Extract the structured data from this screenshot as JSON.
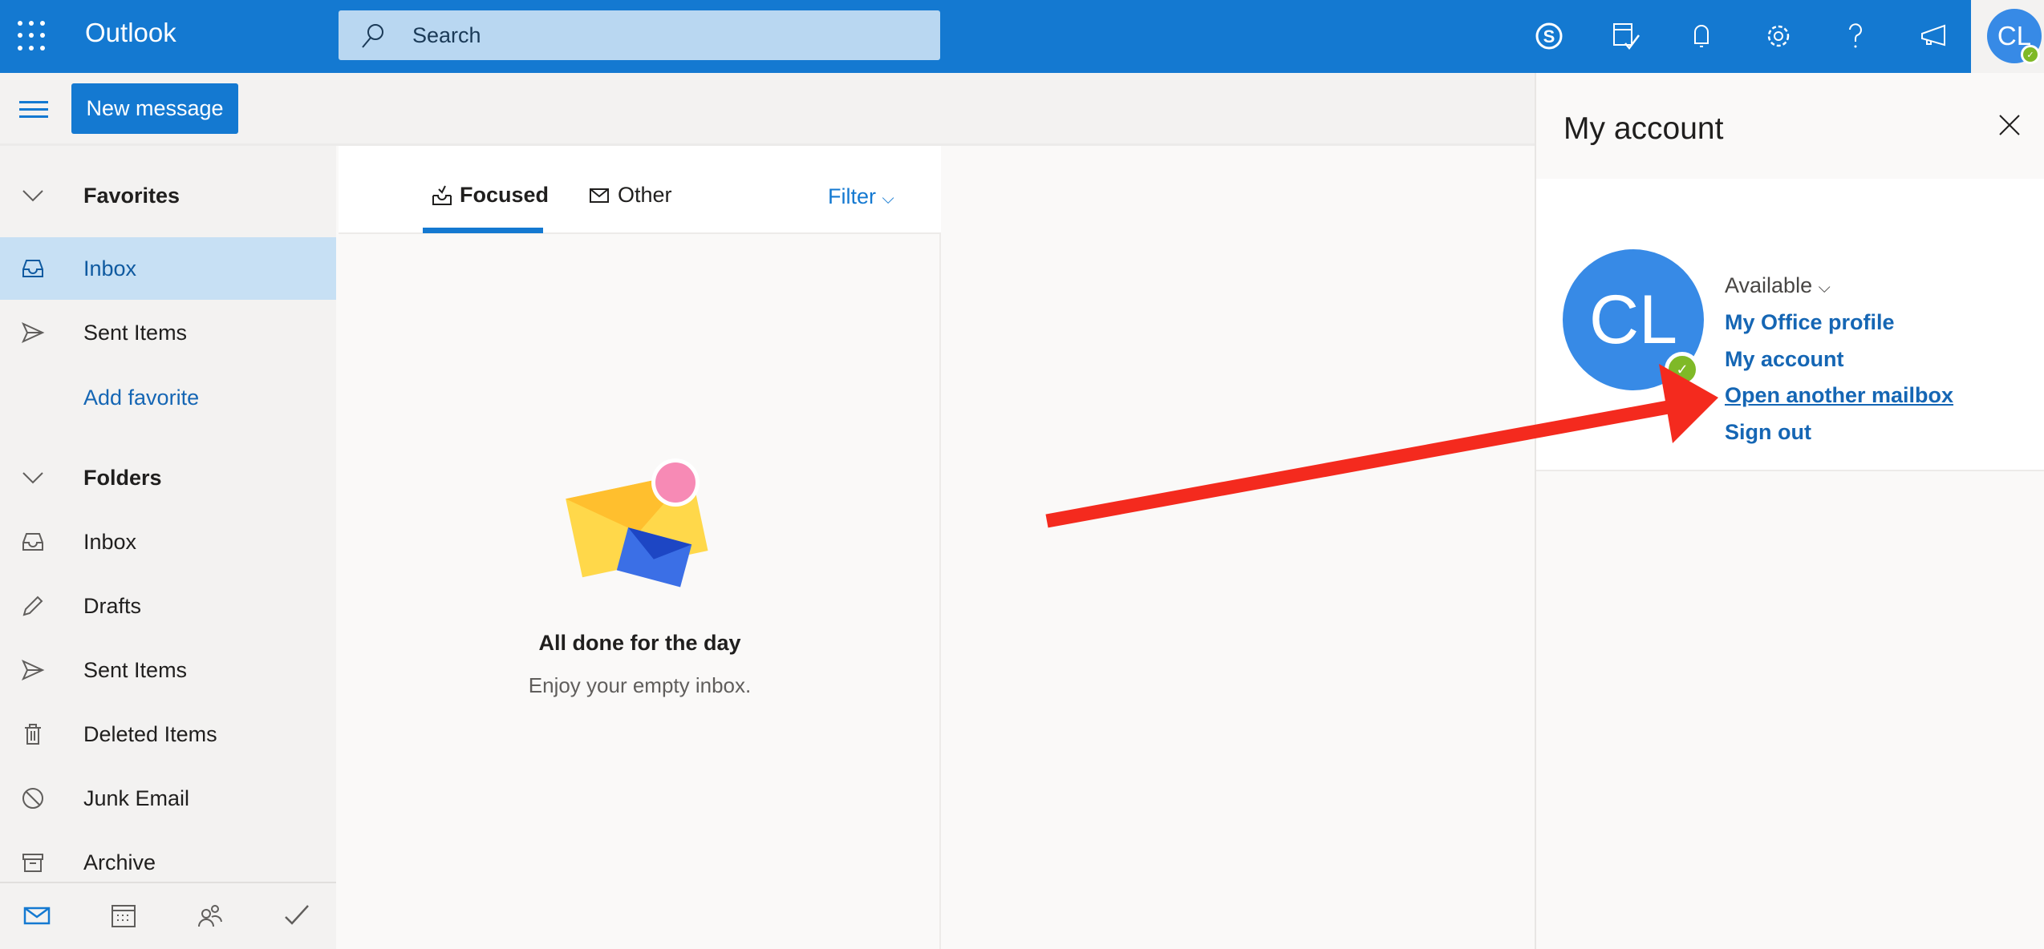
{
  "app": {
    "title": "Outlook",
    "brand_color": "#1479d1"
  },
  "search": {
    "placeholder": "Search"
  },
  "topbar": {
    "icons": [
      "skype-icon",
      "my-day-icon",
      "bell-icon",
      "gear-icon",
      "help-icon",
      "feedback-megaphone-icon"
    ],
    "avatar_initials": "CL"
  },
  "toolbar": {
    "new_message": "New message"
  },
  "sidebar": {
    "favorites": "Favorites",
    "favorite_items": [
      {
        "label": "Inbox",
        "icon": "inbox-icon"
      },
      {
        "label": "Sent Items",
        "icon": "send-icon"
      }
    ],
    "add_favorite": "Add favorite",
    "folders": "Folders",
    "folder_items": [
      {
        "label": "Inbox",
        "icon": "inbox-icon"
      },
      {
        "label": "Drafts",
        "icon": "pencil-icon"
      },
      {
        "label": "Sent Items",
        "icon": "send-icon"
      },
      {
        "label": "Deleted Items",
        "icon": "trash-icon"
      },
      {
        "label": "Junk Email",
        "icon": "blocked-icon"
      },
      {
        "label": "Archive",
        "icon": "archive-icon"
      }
    ]
  },
  "bottom_nav": [
    "mail-icon",
    "calendar-icon",
    "people-icon",
    "todo-icon"
  ],
  "message_list": {
    "tabs": [
      {
        "label": "Focused",
        "active": true
      },
      {
        "label": "Other",
        "active": false
      }
    ],
    "filter": "Filter",
    "empty_title": "All done for the day",
    "empty_subtitle": "Enjoy your empty inbox."
  },
  "account_panel": {
    "title": "My account",
    "initials": "CL",
    "status": "Available",
    "status_color": "#7fb927",
    "links": [
      "My Office profile",
      "My account",
      "Open another mailbox",
      "Sign out"
    ],
    "highlighted_link": "Open another mailbox",
    "annotation_arrow_color": "#f42a1e"
  }
}
